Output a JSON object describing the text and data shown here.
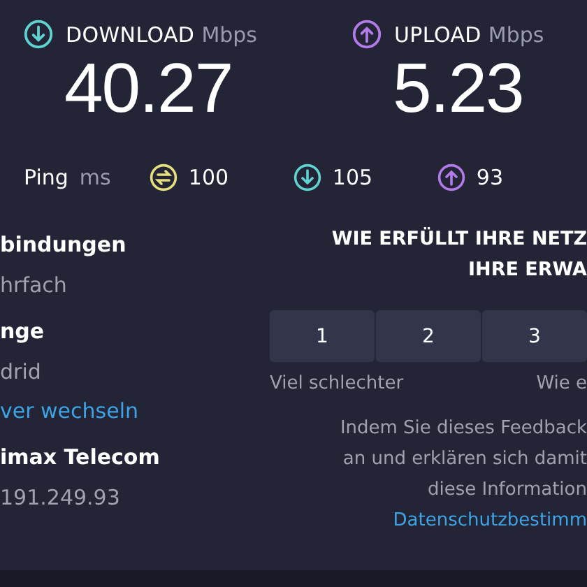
{
  "speeds": [
    {
      "kind": "download",
      "label": "DOWNLOAD",
      "unit": "Mbps",
      "value": "40.27"
    },
    {
      "kind": "upload",
      "label": "UPLOAD",
      "unit": "Mbps",
      "value": "5.23"
    }
  ],
  "ping": {
    "label": "Ping",
    "unit": "ms",
    "readings": [
      {
        "kind": "idle",
        "value": "100"
      },
      {
        "kind": "download",
        "value": "105"
      },
      {
        "kind": "upload",
        "value": "93"
      }
    ]
  },
  "info": [
    {
      "kind": "heading",
      "text": "bindungen"
    },
    {
      "kind": "value",
      "text": "hrfach"
    },
    {
      "kind": "heading",
      "text": "nge"
    },
    {
      "kind": "value",
      "text": "drid"
    },
    {
      "kind": "link",
      "text": "ver wechseln"
    },
    {
      "kind": "heading",
      "text": "imax Telecom"
    },
    {
      "kind": "value",
      "text": "191.249.93"
    }
  ],
  "feedback": {
    "heading": [
      "WIE ERFÜLLT IHRE NETZ",
      "IHRE ERWA"
    ],
    "ratings": [
      {
        "label": "1",
        "selected": false
      },
      {
        "label": "2",
        "selected": false
      },
      {
        "label": "3",
        "selected": false
      }
    ],
    "scale": [
      "Viel schlechter",
      "Wie e"
    ],
    "note": [
      "Indem Sie dieses Feedback",
      "an und erklären sich damit",
      "diese Information"
    ],
    "link": "Datenschutzbestimm"
  }
}
